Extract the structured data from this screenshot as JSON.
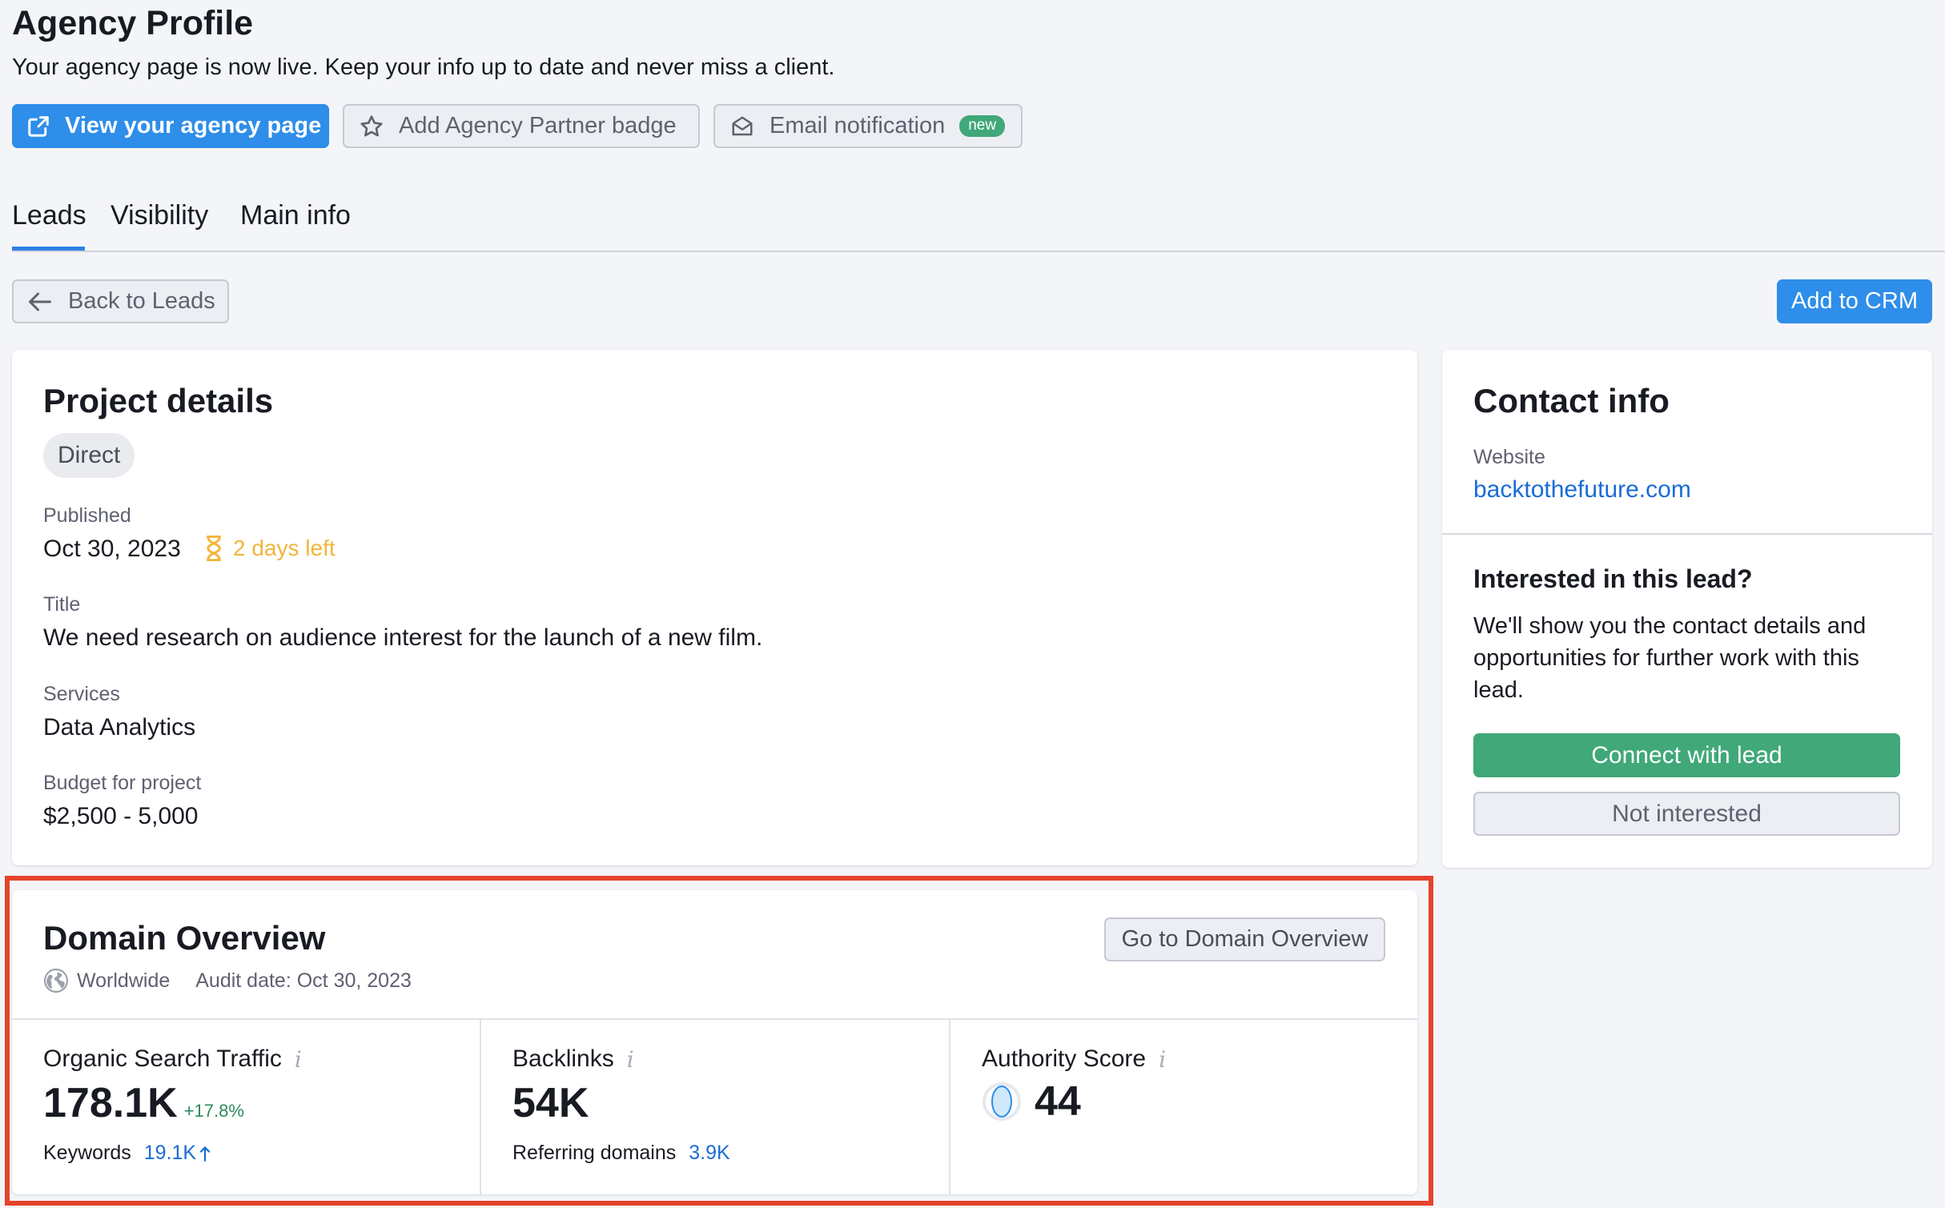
{
  "header": {
    "title": "Agency Profile",
    "subtitle": "Your agency page is now live. Keep your info up to date and never miss a client.",
    "buttons": {
      "view_page": "View your agency page",
      "partner_badge": "Add Agency Partner badge",
      "email_notification": "Email notification",
      "new_badge": "new"
    }
  },
  "tabs": [
    {
      "label": "Leads"
    },
    {
      "label": "Visibility"
    },
    {
      "label": "Main info"
    }
  ],
  "toolbar": {
    "back_label": "Back to Leads",
    "add_crm_label": "Add to CRM"
  },
  "project": {
    "title": "Project details",
    "type_chip": "Direct",
    "published_label": "Published",
    "published_value": "Oct 30, 2023",
    "days_left": "2 days left",
    "title_label": "Title",
    "title_value": "We need research on audience interest for the launch of a new film.",
    "services_label": "Services",
    "services_value": "Data Analytics",
    "budget_label": "Budget for project",
    "budget_value": "$2,500 - 5,000"
  },
  "contact": {
    "title": "Contact info",
    "website_label": "Website",
    "website_value": "backtothefuture.com",
    "interest_heading": "Interested in this lead?",
    "interest_text": "We'll show you the contact details and opportunities for further work with this lead.",
    "connect_label": "Connect with lead",
    "not_interested_label": "Not interested"
  },
  "domain": {
    "title": "Domain Overview",
    "region": "Worldwide",
    "audit_date": "Audit date: Oct 30, 2023",
    "go_button": "Go to Domain Overview",
    "metrics": {
      "organic": {
        "title": "Organic Search Traffic",
        "value": "178.1K",
        "delta": "+17.8%",
        "sub_label": "Keywords",
        "sub_value": "19.1K"
      },
      "backlinks": {
        "title": "Backlinks",
        "value": "54K",
        "sub_label": "Referring domains",
        "sub_value": "3.9K"
      },
      "authority": {
        "title": "Authority Score",
        "value": "44"
      }
    }
  },
  "colors": {
    "primary": "#2e8ee9",
    "success": "#40a879",
    "warning": "#f2b53b",
    "link": "#1a6cd6",
    "highlight": "#e5432b"
  },
  "icons": {
    "external_link": "external-link-icon",
    "star": "star-icon",
    "envelope": "envelope-icon",
    "arrow_left": "arrow-left-icon",
    "hourglass": "hourglass-icon",
    "globe": "globe-icon",
    "info": "info-icon",
    "arrow_up": "arrow-up-icon"
  }
}
